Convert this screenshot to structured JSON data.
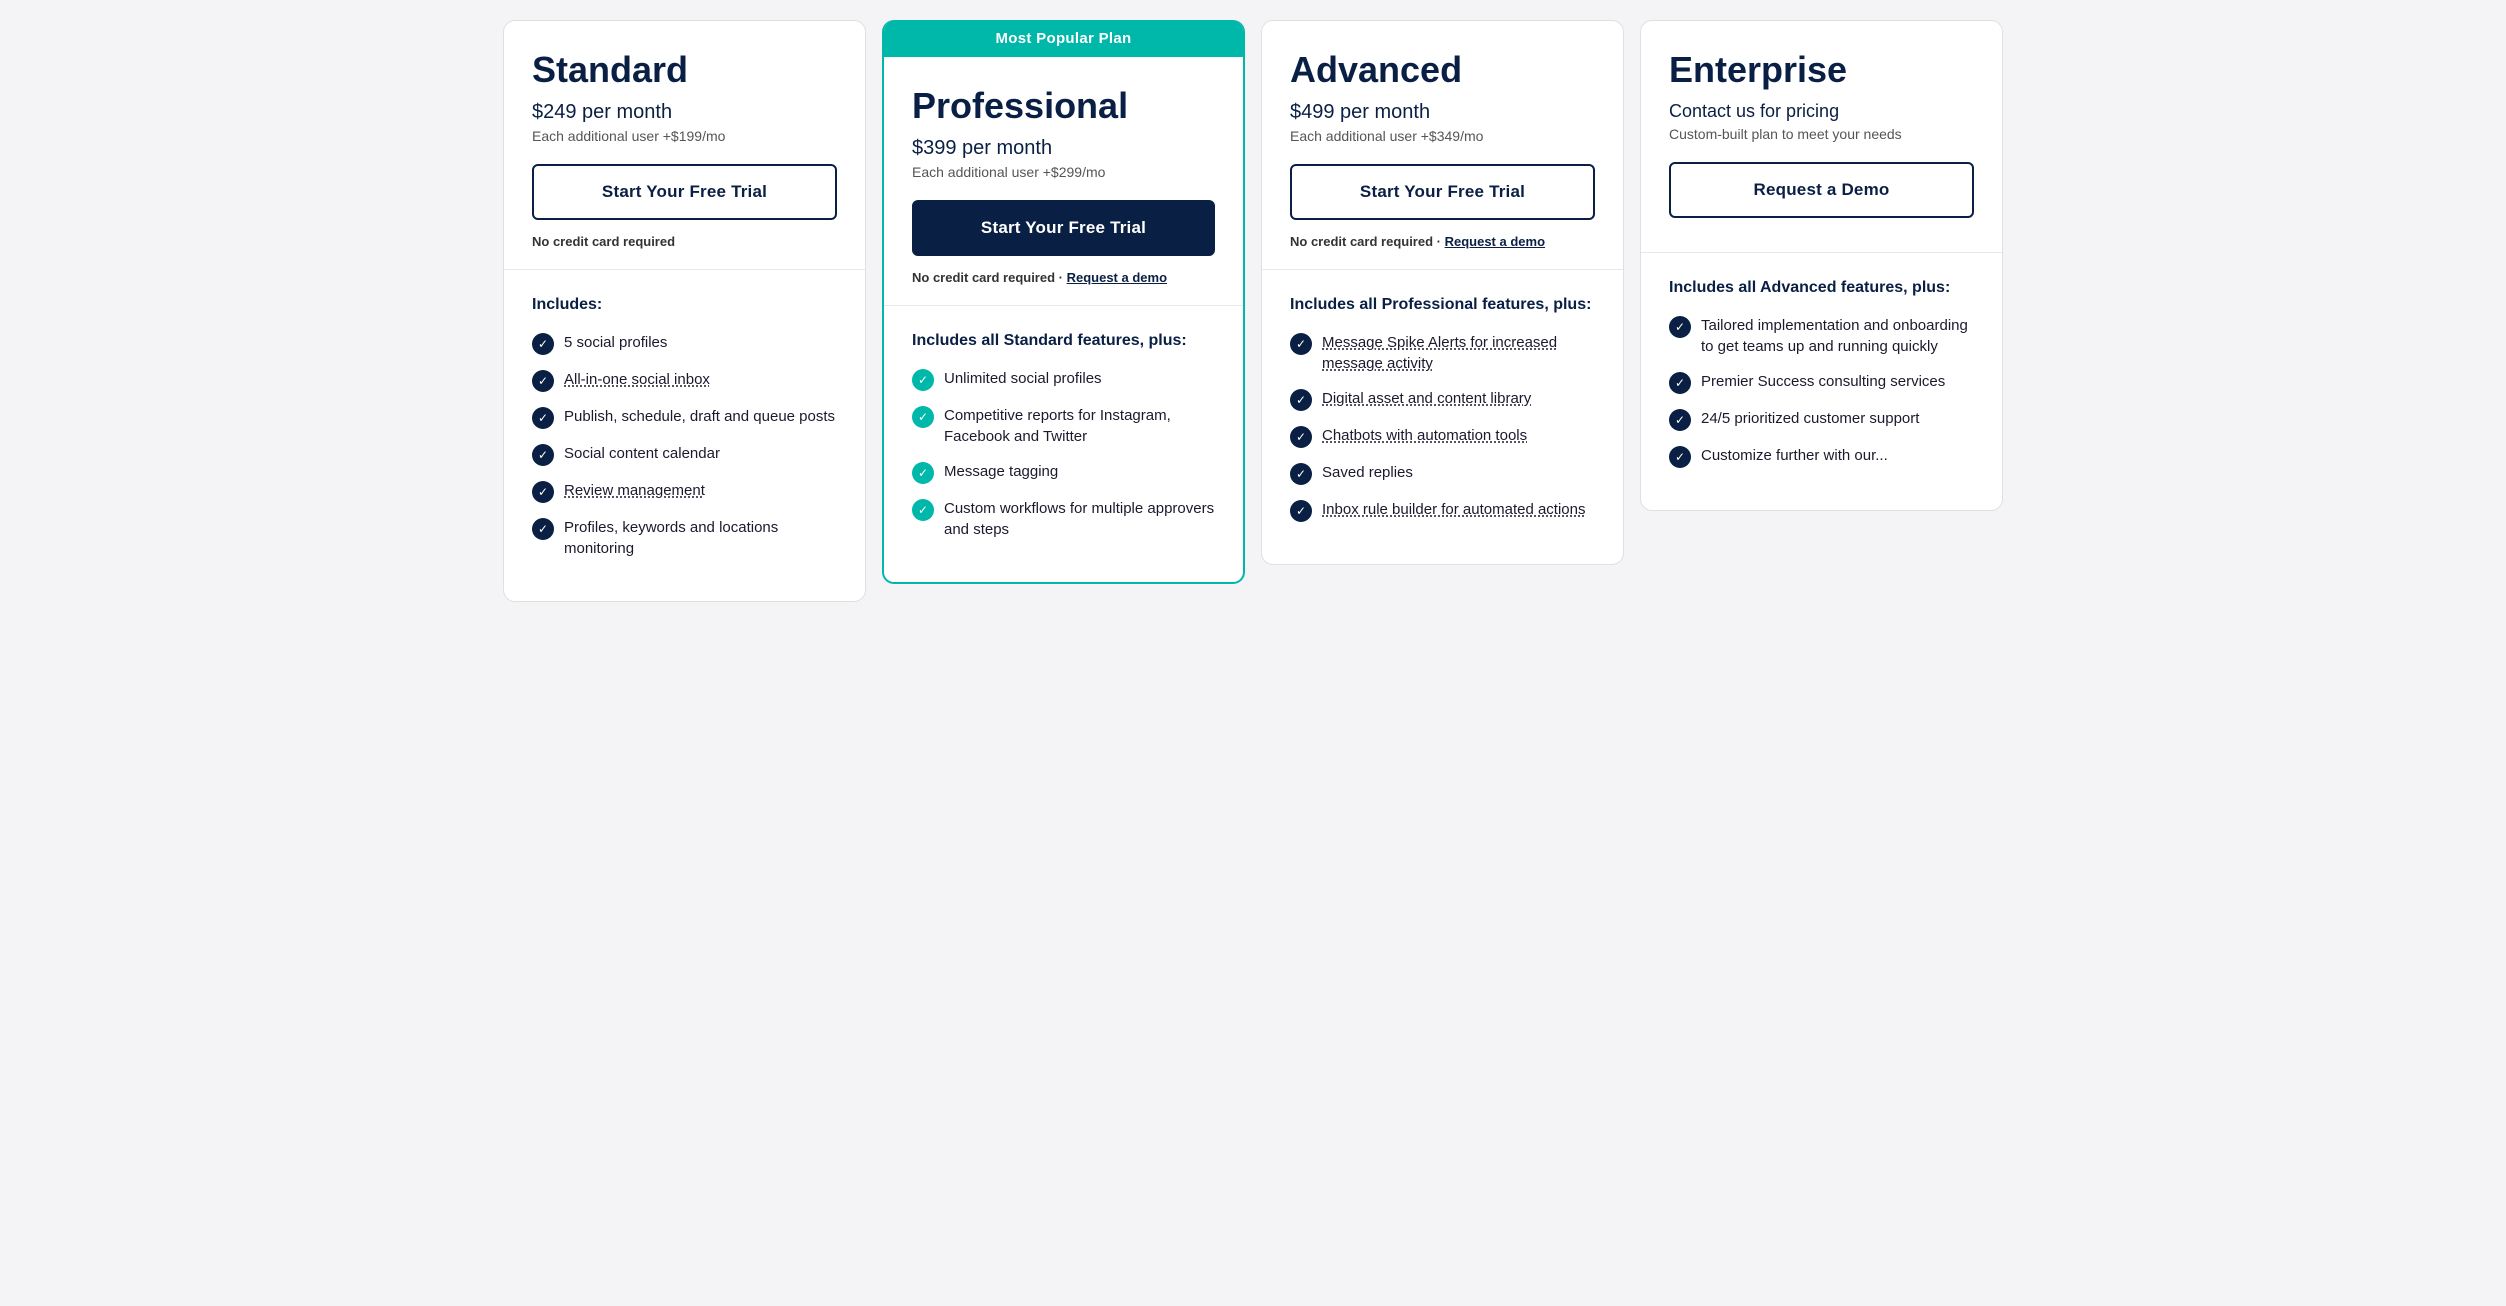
{
  "plans": [
    {
      "id": "standard",
      "name": "Standard",
      "popular": false,
      "popular_label": "",
      "price": "$249 per month",
      "price_sub": "Each additional user +$199/mo",
      "cta_label": "Start Your Free Trial",
      "cta_featured": false,
      "no_cc": "No credit card required",
      "no_cc_link": null,
      "features_heading": "Includes:",
      "features": [
        {
          "text": "5 social profiles",
          "dotted": false,
          "icon": "dark"
        },
        {
          "text": "All-in-one social inbox",
          "dotted": true,
          "icon": "dark"
        },
        {
          "text": "Publish, schedule, draft and queue posts",
          "dotted": false,
          "icon": "dark"
        },
        {
          "text": "Social content calendar",
          "dotted": false,
          "icon": "dark"
        },
        {
          "text": "Review management",
          "dotted": true,
          "icon": "dark"
        },
        {
          "text": "Profiles, keywords and locations monitoring",
          "dotted": false,
          "icon": "dark"
        }
      ]
    },
    {
      "id": "professional",
      "name": "Professional",
      "popular": true,
      "popular_label": "Most Popular Plan",
      "price": "$399 per month",
      "price_sub": "Each additional user +$299/mo",
      "cta_label": "Start Your Free Trial",
      "cta_featured": true,
      "no_cc": "No credit card required",
      "no_cc_link": "Request a demo",
      "features_heading": "Includes all Standard features, plus:",
      "features": [
        {
          "text": "Unlimited social profiles",
          "dotted": false,
          "icon": "teal"
        },
        {
          "text": "Competitive reports for Instagram, Facebook and Twitter",
          "dotted": false,
          "icon": "teal"
        },
        {
          "text": "Message tagging",
          "dotted": false,
          "icon": "teal"
        },
        {
          "text": "Custom workflows for multiple approvers and steps",
          "dotted": false,
          "icon": "teal"
        }
      ]
    },
    {
      "id": "advanced",
      "name": "Advanced",
      "popular": false,
      "popular_label": "",
      "price": "$499 per month",
      "price_sub": "Each additional user +$349/mo",
      "cta_label": "Start Your Free Trial",
      "cta_featured": false,
      "no_cc": "No credit card required",
      "no_cc_link": "Request a demo",
      "features_heading": "Includes all Professional features, plus:",
      "features": [
        {
          "text": "Message Spike Alerts for increased message activity",
          "dotted": true,
          "icon": "dark"
        },
        {
          "text": "Digital asset and content library",
          "dotted": true,
          "icon": "dark"
        },
        {
          "text": "Chatbots with automation tools",
          "dotted": true,
          "icon": "dark"
        },
        {
          "text": "Saved replies",
          "dotted": false,
          "icon": "dark"
        },
        {
          "text": "Inbox rule builder for automated actions",
          "dotted": true,
          "icon": "dark"
        }
      ]
    },
    {
      "id": "enterprise",
      "name": "Enterprise",
      "popular": false,
      "popular_label": "",
      "price": "Contact us for pricing",
      "price_sub": "Custom-built plan to meet your needs",
      "cta_label": "Request a Demo",
      "cta_featured": false,
      "no_cc": null,
      "no_cc_link": null,
      "features_heading": "Includes all Advanced features, plus:",
      "features": [
        {
          "text": "Tailored implementation and onboarding to get teams up and running quickly",
          "dotted": false,
          "icon": "dark"
        },
        {
          "text": "Premier Success consulting services",
          "dotted": false,
          "icon": "dark"
        },
        {
          "text": "24/5 prioritized customer support",
          "dotted": false,
          "icon": "dark"
        },
        {
          "text": "Customize further with our...",
          "dotted": false,
          "icon": "dark"
        }
      ]
    }
  ]
}
